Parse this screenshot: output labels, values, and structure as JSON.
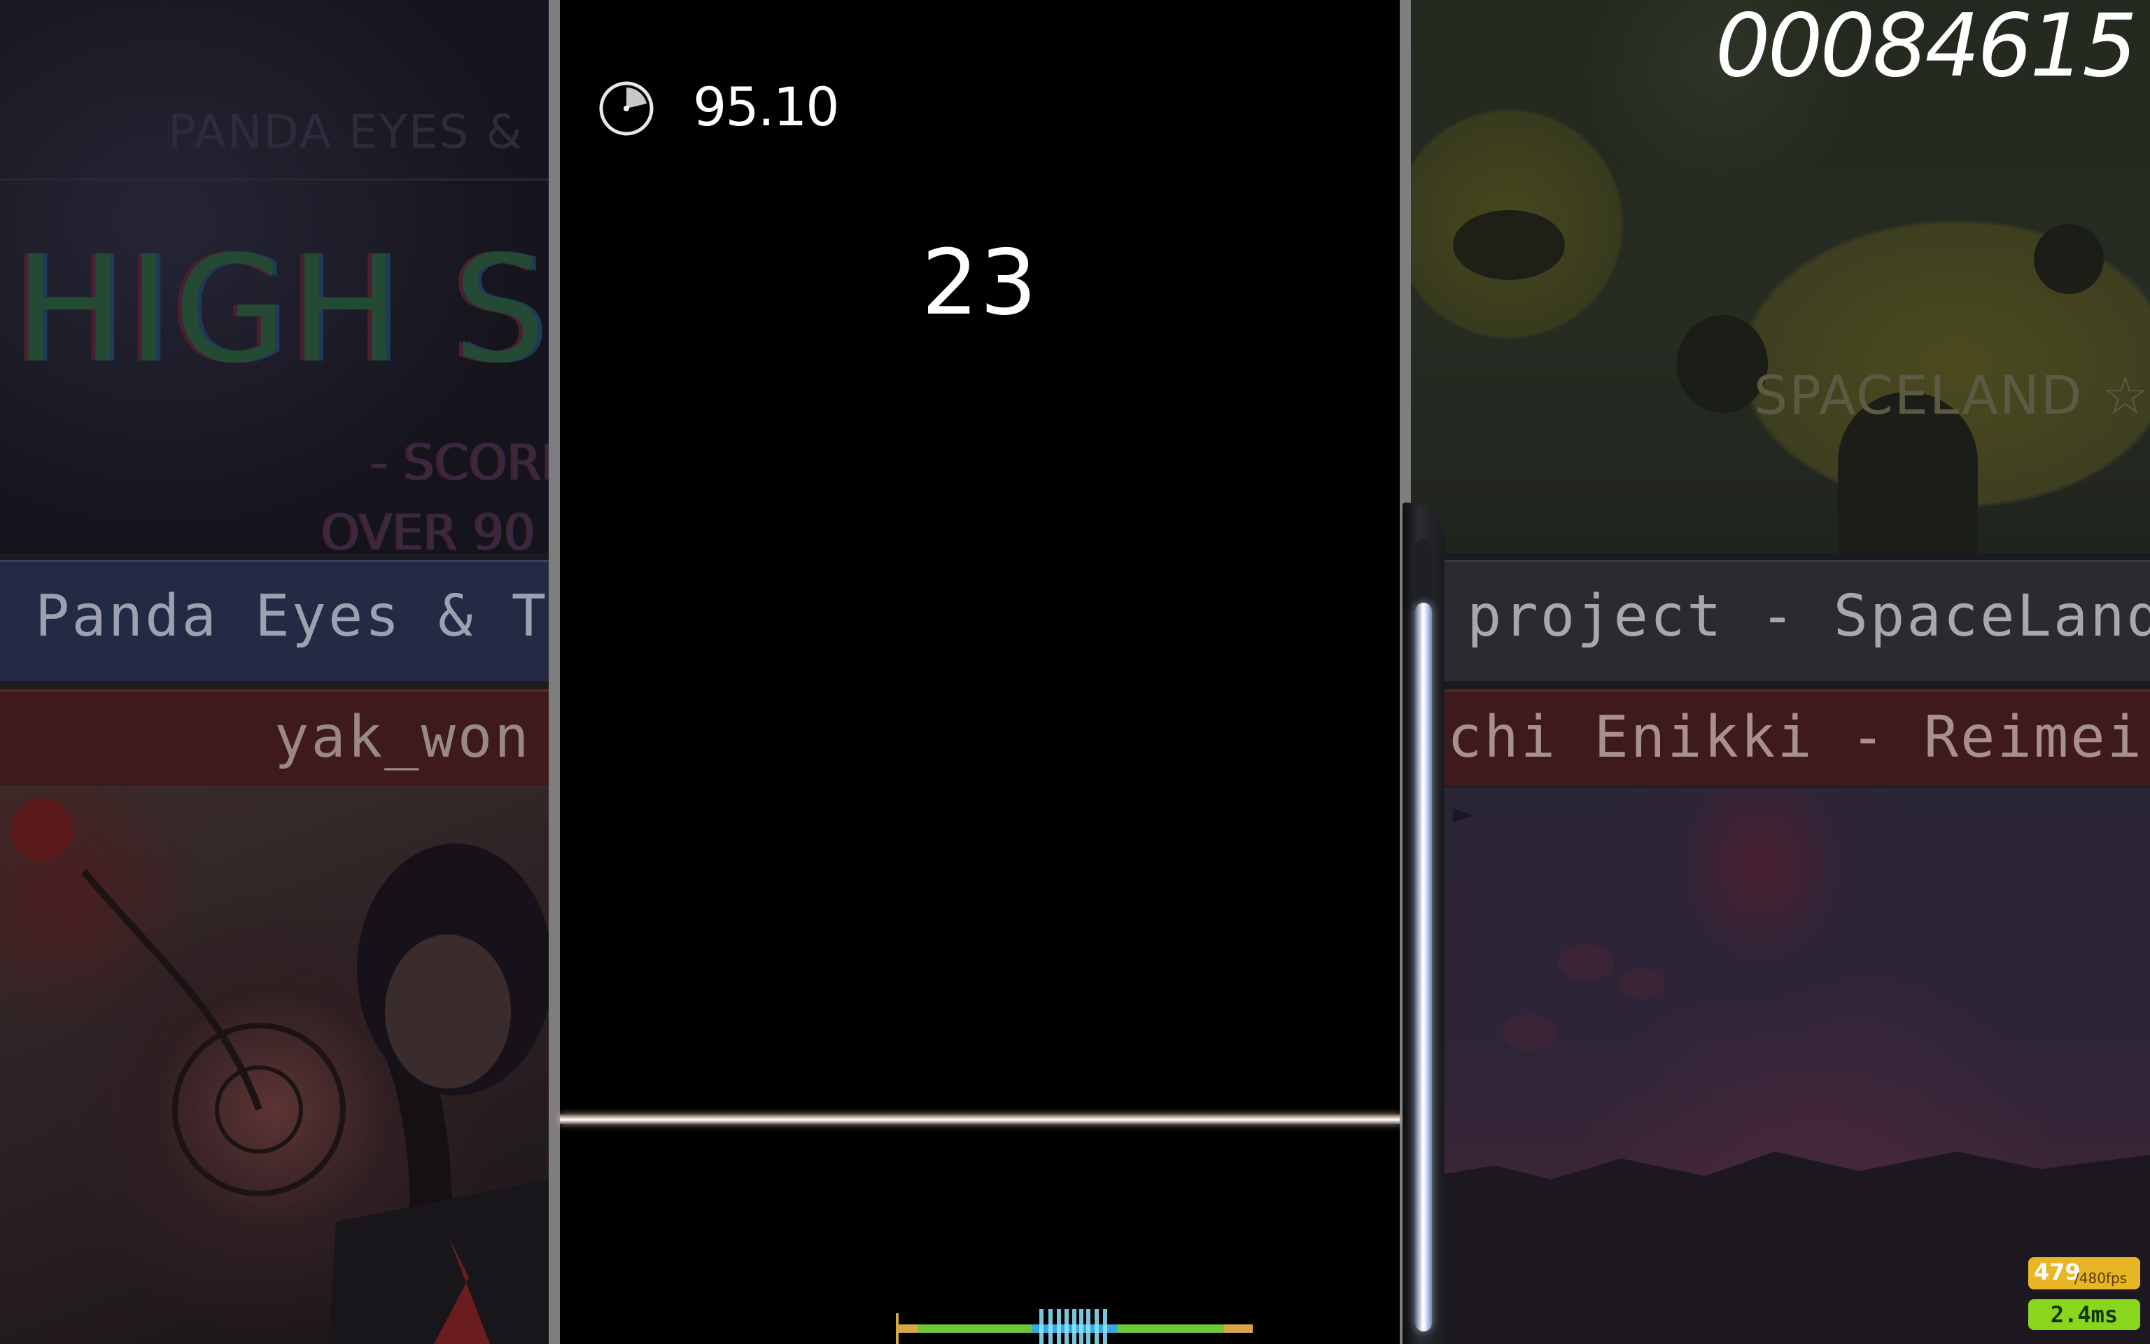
{
  "hud": {
    "score": "00084615",
    "accuracy": "95.10",
    "combo": "23",
    "fps_current": "479",
    "fps_cap": "/480fps",
    "frame_time": "2.4ms",
    "hp_fraction": 0.92
  },
  "background_left": {
    "banner_top_text": "PANDA EYES &",
    "banner_big_text": "HIGH SC",
    "banner_score_text": "- SCORE",
    "banner_over_text": "OVER 90",
    "title_1": "Panda Eyes & Teminite",
    "title_2": "yak_won - s"
  },
  "background_right": {
    "banner_text": "SPACELAND ☆ TOY",
    "title_1": "project - SpaceLand TOYBOX",
    "title_2": "chi Enikki - Reimei Sketchboo"
  },
  "icons": {
    "accuracy": "accuracy-pie-icon"
  },
  "colors": {
    "fps_badge": "#e8b624",
    "latency_badge": "#8ad61c",
    "hit_300": "#3aa8e0",
    "hit_100": "#6fc63a",
    "hit_50": "#d8a64a"
  }
}
